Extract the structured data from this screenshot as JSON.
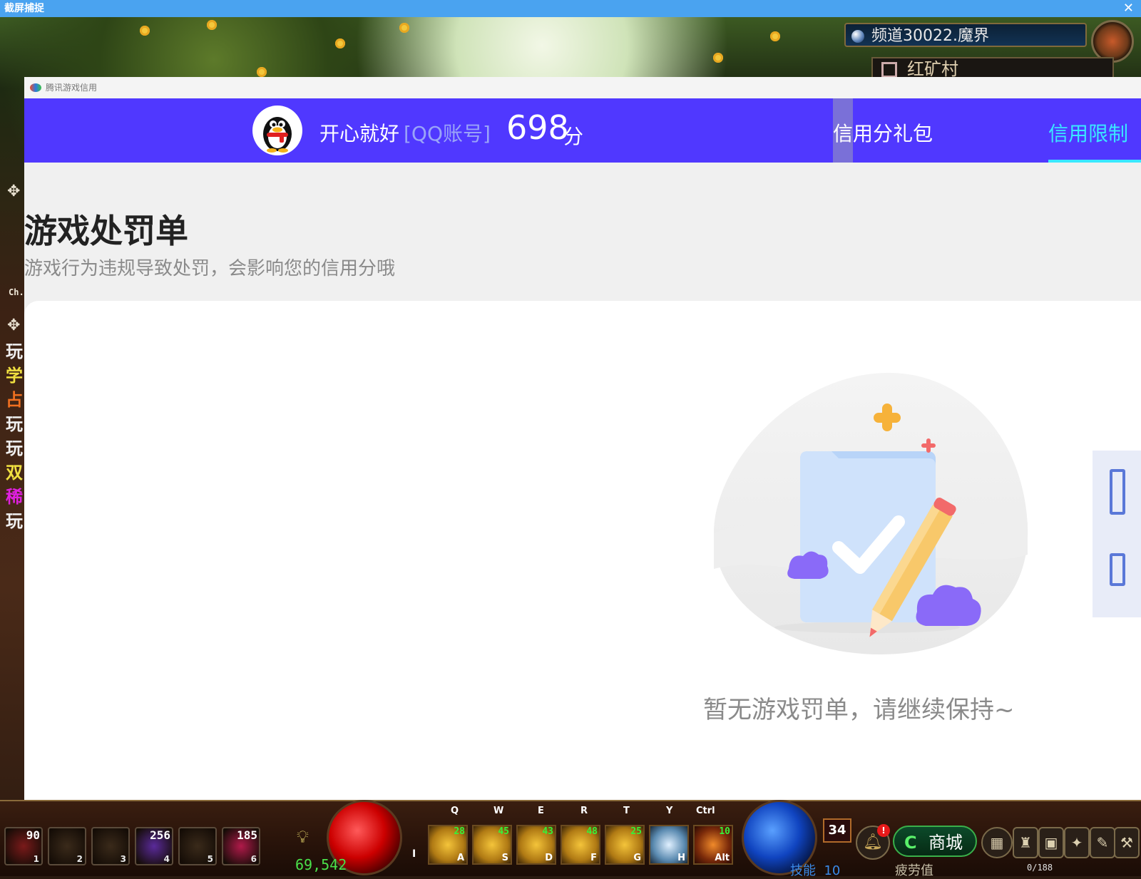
{
  "capture_window": {
    "title": "截屏捕捉",
    "close_glyph": "✕"
  },
  "game": {
    "channel": "频道30022.魔界",
    "location": "红矿村",
    "left_chat_label": "Ch.",
    "left_tags": [
      {
        "text": "玩",
        "color": "#f0f0f0"
      },
      {
        "text": "学",
        "color": "#f0e040"
      },
      {
        "text": "占",
        "color": "#f07020"
      },
      {
        "text": "玩",
        "color": "#f0f0f0"
      },
      {
        "text": "玩",
        "color": "#f0f0f0"
      },
      {
        "text": "双",
        "color": "#f0e040"
      },
      {
        "text": "稀",
        "color": "#e020e0"
      },
      {
        "text": "玩",
        "color": "#f0f0f0"
      }
    ],
    "hud": {
      "quick_slots": [
        {
          "count": "90",
          "key": "1"
        },
        {
          "count": "",
          "key": "2"
        },
        {
          "count": "",
          "key": "3"
        },
        {
          "count": "256",
          "key": "4"
        },
        {
          "count": "",
          "key": "5"
        },
        {
          "count": "185",
          "key": "6"
        }
      ],
      "top_keys": [
        "Q",
        "W",
        "E",
        "R",
        "T",
        "Y",
        "Ctrl"
      ],
      "skills": [
        {
          "level": "28",
          "key": "A"
        },
        {
          "level": "45",
          "key": "S"
        },
        {
          "level": "43",
          "key": "D"
        },
        {
          "level": "48",
          "key": "F"
        },
        {
          "level": "25",
          "key": "G"
        },
        {
          "level": "",
          "key": "H"
        },
        {
          "level": "10",
          "key": "Alt"
        }
      ],
      "side_key": "I",
      "gold": "69,542",
      "character_level": "34",
      "notification_badge": "!",
      "shop_label": "商城",
      "shop_icon": "C",
      "skill_points_label": "技能",
      "skill_points_value": "10",
      "fatigue_label": "疲劳值",
      "fatigue_value": "0/188"
    }
  },
  "credit_window": {
    "title": "腾讯游戏信用",
    "user": {
      "nickname": "开心就好",
      "account_type": "[QQ账号]",
      "score": "698",
      "score_unit": "分"
    },
    "nav": {
      "gift": "信用分礼包",
      "limit": "信用限制"
    },
    "page": {
      "title": "游戏处罚单",
      "subtitle": "游戏行为违规导致处罚，会影响您的信用分哦",
      "empty_message": "暂无游戏罚单，请继续保持~"
    },
    "colors": {
      "header": "#5038ff",
      "active_tab": "#3ae8ff",
      "page_bg": "#f0f0f0"
    }
  }
}
